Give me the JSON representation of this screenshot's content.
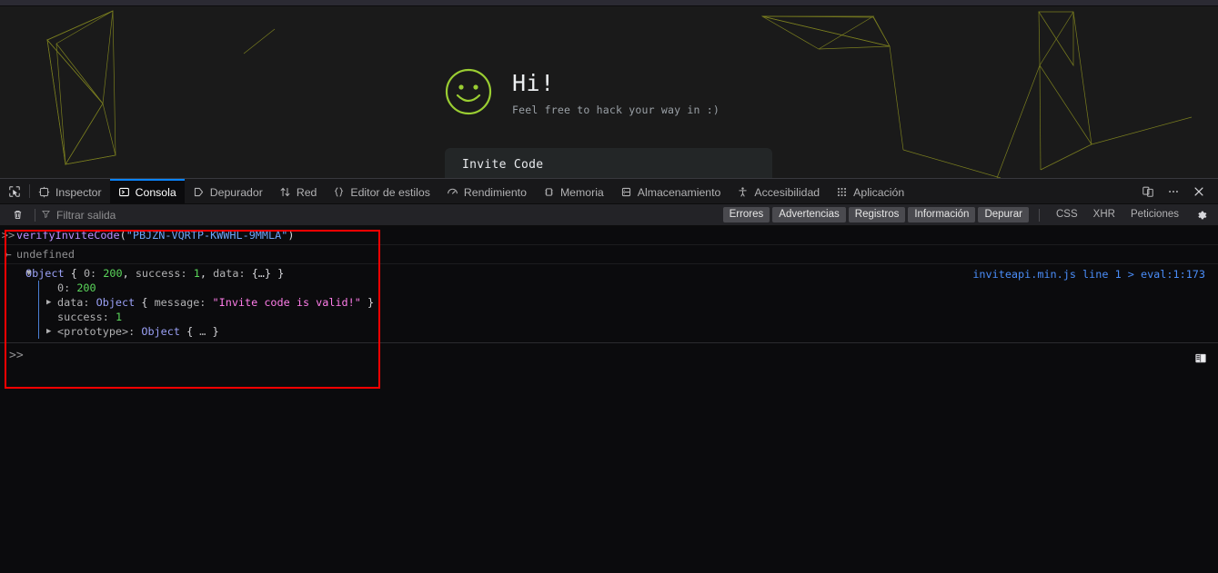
{
  "page": {
    "hero": {
      "icon": "smiley-face-icon",
      "title": "Hi!",
      "subtitle": "Feel free to hack your way in :)"
    },
    "form": {
      "label": "Invite Code"
    },
    "accent_color": "#9acd32",
    "background_color": "#1a1a1a"
  },
  "devtools": {
    "picker_icon": "element-picker-icon",
    "tabs": [
      {
        "label": "Inspector",
        "icon": "inspector-icon",
        "active": false
      },
      {
        "label": "Consola",
        "icon": "console-icon",
        "active": true
      },
      {
        "label": "Depurador",
        "icon": "debugger-icon",
        "active": false
      },
      {
        "label": "Red",
        "icon": "network-icon",
        "active": false
      },
      {
        "label": "Editor de estilos",
        "icon": "style-editor-icon",
        "active": false
      },
      {
        "label": "Rendimiento",
        "icon": "performance-icon",
        "active": false
      },
      {
        "label": "Memoria",
        "icon": "memory-icon",
        "active": false
      },
      {
        "label": "Almacenamiento",
        "icon": "storage-icon",
        "active": false
      },
      {
        "label": "Accesibilidad",
        "icon": "accessibility-icon",
        "active": false
      },
      {
        "label": "Aplicación",
        "icon": "application-icon",
        "active": false
      }
    ],
    "toolbar_right": [
      {
        "name": "responsive-design-mode-icon"
      },
      {
        "name": "meatball-menu-icon"
      },
      {
        "name": "close-icon"
      }
    ],
    "active_tab_accent": "#0a84ff",
    "filter_bar": {
      "trash_icon": "trash-icon",
      "funnel_icon": "funnel-icon",
      "placeholder": "Filtrar salida",
      "value": "",
      "toggles": [
        {
          "label": "Errores",
          "active": true
        },
        {
          "label": "Advertencias",
          "active": true
        },
        {
          "label": "Registros",
          "active": true
        },
        {
          "label": "Información",
          "active": true
        },
        {
          "label": "Depurar",
          "active": true
        },
        {
          "label": "CSS",
          "active": false
        },
        {
          "label": "XHR",
          "active": false
        },
        {
          "label": "Peticiones",
          "active": false
        }
      ],
      "gear_icon": "gear-icon"
    },
    "console": {
      "input_chevron": ">>",
      "return_chevron": "←",
      "entry_function": "verifyInviteCode",
      "entry_open_paren": "(",
      "entry_arg": "\"PBJZN-VQRTP-KWWHL-9MMLA\"",
      "entry_close_paren": ")",
      "return_value": "undefined",
      "object_summary": {
        "twisty": "▼",
        "label": "Object",
        "open": "{",
        "k0": "0:",
        "v0": "200",
        "comma0": ",",
        "k1": "success:",
        "v1": "1",
        "comma1": ",",
        "k2": "data:",
        "v2": "{…}",
        "close": "}"
      },
      "object_children": [
        {
          "twisty": "",
          "key": "0:",
          "value": "200",
          "value_kind": "number"
        },
        {
          "twisty": "▶",
          "key": "data:",
          "value": "Object { message: \"Invite code is valid!\" }",
          "value_kind": "object-with-string"
        },
        {
          "twisty": "",
          "key": "success:",
          "value": "1",
          "value_kind": "number"
        },
        {
          "twisty": "▶",
          "key": "<prototype>:",
          "value": "Object { … }",
          "value_kind": "object"
        }
      ],
      "data_child": {
        "label": "Object",
        "open": "{",
        "inner_key": "message:",
        "inner_value": "\"Invite code is valid!\"",
        "close": "}"
      },
      "proto_child": {
        "label": "Object",
        "open": "{",
        "ellipsis": "…",
        "close": "}"
      },
      "source_link": "inviteapi.min.js line 1 > eval:1:173",
      "prompt_chevron": ">>",
      "prompt_value": "",
      "editor_mode_icon": "split-editor-icon"
    }
  },
  "annotation": {
    "shape": "rectangle",
    "color": "#ff0000"
  }
}
